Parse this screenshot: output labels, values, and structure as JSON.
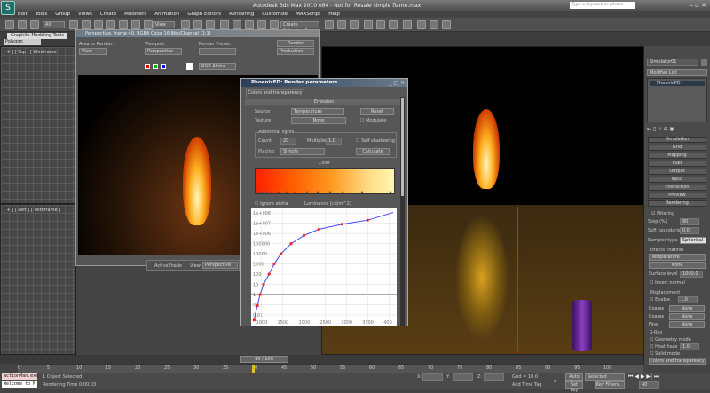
{
  "app": {
    "title": "Autodesk 3ds Max 2010 x64 - Not for Resale  simple flame.max",
    "search_placeholder": "Type a keyword or phrase"
  },
  "menu": [
    "Edit",
    "Tools",
    "Group",
    "Views",
    "Create",
    "Modifiers",
    "Animation",
    "Graph Editors",
    "Rendering",
    "Customize",
    "MAXScript",
    "Help"
  ],
  "toolbar": {
    "selection_filter": "All",
    "ref_coord": "View",
    "named_selection": "Create Selection Se"
  },
  "ribbon": {
    "tab": "Graphite Modeling Tools",
    "panel": "Polygon Modeling"
  },
  "viewports": {
    "top": "[ + ] [ Top ] [ Wireframe ]",
    "left": "[ + ] [ Left ] [ Wireframe ]"
  },
  "render_frame": {
    "title": "Perspective, frame 40, RGBA Color 16 Bits/Channel (1:1)",
    "area_label": "Area to Render:",
    "area_value": "View",
    "viewport_label": "Viewport:",
    "viewport_value": "Perspective",
    "preset_label": "Render Preset:",
    "preset_value": "-------------------",
    "render_button": "Render",
    "production_value": "Production",
    "channel_value": "RGB Alpha",
    "activeshade_label": "ActiveShade",
    "view_label": "View:",
    "view_value": "Perspective"
  },
  "phoenix": {
    "title": "PhoenixFD: Render parameters",
    "tab": "Colors and transparency",
    "section": "Emission",
    "source_label": "Source",
    "source_value": "Temperature",
    "reset": "Reset",
    "texture_label": "Texture",
    "texture_value": "None",
    "modulate": "Modulate",
    "lights_group": "Additional lights",
    "count_label": "Count",
    "count_value": "20",
    "multiplier_label": "Multiplier",
    "multiplier_value": "1.0",
    "self_shadowing": "Self shadowing",
    "placing_label": "Placing",
    "placing_value": "Simple",
    "calculate": "Calculate",
    "color_label": "Color",
    "ignore_alpha": "Ignore alpha",
    "luminance_label": "Luminance [cd/m^2]"
  },
  "chart_data": {
    "type": "line",
    "ylabel": "Luminance [cd/m^2]",
    "yscale": "log",
    "y_ticks": [
      "1e+008",
      "1e+007",
      "1e+006",
      "100000",
      "10000",
      "1000",
      "100",
      "10",
      "1",
      "0.1",
      "0.01"
    ],
    "x_ticks": [
      "1000",
      "1500",
      "2000",
      "2500",
      "3000",
      "3500",
      "400"
    ],
    "xlim": [
      800,
      4100
    ],
    "ylim_log10": [
      -2.7,
      8.1
    ],
    "points": [
      [
        830,
        -2.5
      ],
      [
        900,
        -1.1
      ],
      [
        970,
        0
      ],
      [
        1050,
        1
      ],
      [
        1180,
        2
      ],
      [
        1300,
        3
      ],
      [
        1460,
        4
      ],
      [
        1700,
        5
      ],
      [
        2000,
        5.8
      ],
      [
        2350,
        6.4
      ],
      [
        2900,
        6.9
      ],
      [
        3500,
        7.3
      ]
    ],
    "colors": {
      "line": "#4040ff",
      "points": "#ff2020"
    }
  },
  "command_panel": {
    "object_name": "Simulator01",
    "modifier_list": "Modifier List",
    "stack_item": "PhoenixFD",
    "rollouts": [
      "Simulation",
      "Grid",
      "Mapping",
      "Fuel",
      "Output",
      "Input",
      "Interaction",
      "Preview",
      "Rendering"
    ],
    "filtering": "Filtering",
    "step_label": "Step (%)",
    "step_value": "90",
    "soft_label": "Soft boundaries",
    "soft_value": "0.0",
    "sampler_label": "Sampler type",
    "sampler_value": "Spherical",
    "effects_group": "Effects channel",
    "effects_value": "Temperature",
    "effects_none": "None",
    "surface_label": "Surface level",
    "surface_value": "1000.0",
    "invert_normal": "Invert normal",
    "displacement_group": "Displacement",
    "enable": "Enable",
    "enable_value": "1.0",
    "coarse1": "Coarse",
    "coarse2": "Coarse",
    "fine": "Fine",
    "none": "None",
    "xray_group": "X-Ray",
    "geometry_mode": "Geometry mode",
    "heat_haze": "Heat haze",
    "heat_value": "1.0",
    "solid_mode": "Solid mode",
    "colors_button": "Colors and transparency"
  },
  "timeline": {
    "frame": "40 / 100",
    "ticks": [
      "0",
      "5",
      "10",
      "15",
      "20",
      "25",
      "30",
      "35",
      "40",
      "45",
      "50",
      "55",
      "60",
      "65",
      "70",
      "75",
      "80",
      "85",
      "90",
      "95",
      "100"
    ],
    "current_fraction": 0.4
  },
  "status": {
    "maxscript1": "actionMan.exe",
    "maxscript2": "Welcome to M",
    "selected": "1 Object Selected",
    "render_time": "Rendering Time  0:00:03",
    "x_label": "X:",
    "y_label": "Y:",
    "z_label": "Z:",
    "grid": "Grid = 10.0",
    "add_time_tag": "Add Time Tag",
    "auto_key": "Auto Key",
    "set_key": "Set Key",
    "key_mode": "Selected",
    "key_filters": "Key Filters...",
    "frame_value": "40"
  }
}
